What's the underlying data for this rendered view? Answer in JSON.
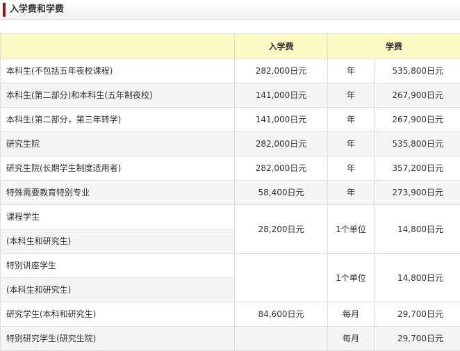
{
  "section": {
    "title": "入学费和学费"
  },
  "table": {
    "header": {
      "entrance": "入学费",
      "tuition": "学费"
    },
    "rows": [
      {
        "cat": "本科生(不包括五年夜校课程)",
        "entrance": "282,000日元",
        "unit": "年",
        "tuition": "535,800日元"
      },
      {
        "cat": "本科生(第二部分)和本科生(五年制夜校)",
        "entrance": "141,000日元",
        "unit": "年",
        "tuition": "267,900日元"
      },
      {
        "cat": "本科生(第二部分，第三年转学)",
        "entrance": "141,000日元",
        "unit": "年",
        "tuition": "267,900日元"
      },
      {
        "cat": "研究生院",
        "entrance": "282,000日元",
        "unit": "年",
        "tuition": "535,800日元"
      },
      {
        "cat": "研究生院(长期学生制度适用者)",
        "entrance": "282,000日元",
        "unit": "年",
        "tuition": "357,200日元"
      },
      {
        "cat": "特殊需要教育特别专业",
        "entrance": "58,400日元",
        "unit": "年",
        "tuition": "273,900日元"
      },
      {
        "cat": "课程学生",
        "cat2": "(本科生和研究生)",
        "entrance": "28,200日元",
        "unit": "1个单位",
        "tuition": "14,800日元"
      },
      {
        "cat": "特别讲座学生",
        "cat2": "(本科生和研究生)",
        "entrance": "",
        "unit": "1个单位",
        "tuition": "14,800日元"
      },
      {
        "cat": "研究学生(本科和研究生)",
        "entrance": "84,600日元",
        "unit": "每月",
        "tuition": "29,700日元"
      },
      {
        "cat": "特别研究学生(研究生院)",
        "entrance": "",
        "unit": "每月",
        "tuition": "29,700日元"
      }
    ]
  }
}
